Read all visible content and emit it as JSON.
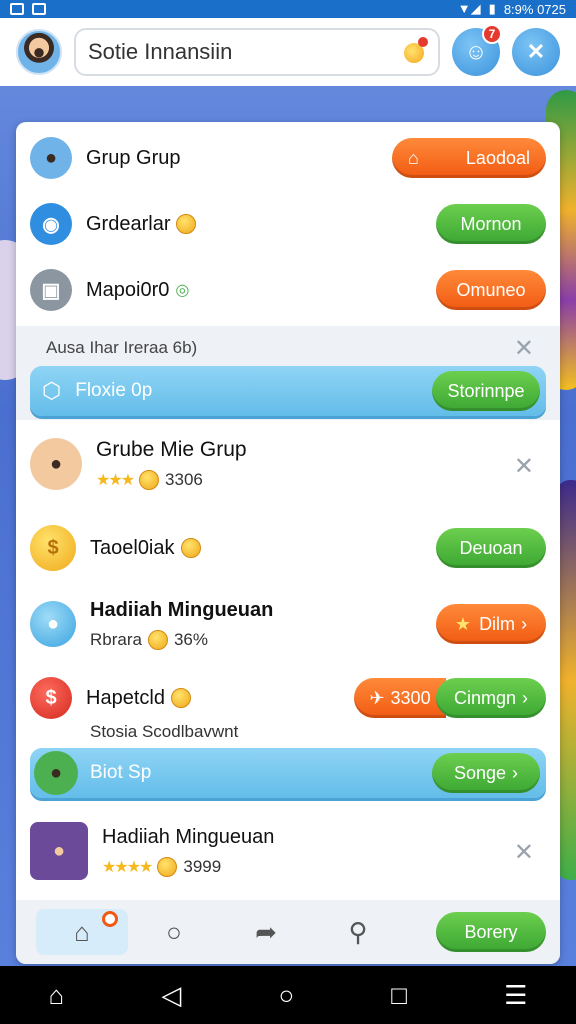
{
  "status_bar": {
    "right_text": "8:9% 0725"
  },
  "header": {
    "search_text": "Sotie Innansiin",
    "notification_badge": "7"
  },
  "rows": {
    "r1": {
      "title": "Grup Grup",
      "button": "Laodoal"
    },
    "r2": {
      "title": "Grdearlar",
      "button": "Mornon"
    },
    "r3": {
      "title": "Mapoi0r0",
      "button": "Omuneo"
    },
    "section1": {
      "heading": "Ausa Ihar Ireraa 6b)",
      "bar_text": "Floxie 0p",
      "bar_button": "Storinnpe"
    },
    "r4": {
      "title": "Grube Mie Grup",
      "rating": "3306"
    },
    "r5": {
      "title": "Taoel0iak",
      "button": "Deuoan"
    },
    "r6": {
      "title": "Hadiiah Mingueuan",
      "sub": "Rbrara",
      "sub_value": "36%",
      "button": "Dilm"
    },
    "r7": {
      "title": "Hapetcld",
      "price": "3300",
      "button": "Cinmgn"
    },
    "section2": {
      "heading": "Stosia Scodlbavwnt",
      "bar_text": "Biot Sp",
      "bar_button": "Songe"
    },
    "r8": {
      "title": "Hadiiah Mingueuan",
      "rating": "3999"
    }
  },
  "tabbar": {
    "action_button": "Borery"
  },
  "colors": {
    "orange": "#f15a12",
    "green": "#3ba733",
    "blue_bar": "#63bde9"
  }
}
